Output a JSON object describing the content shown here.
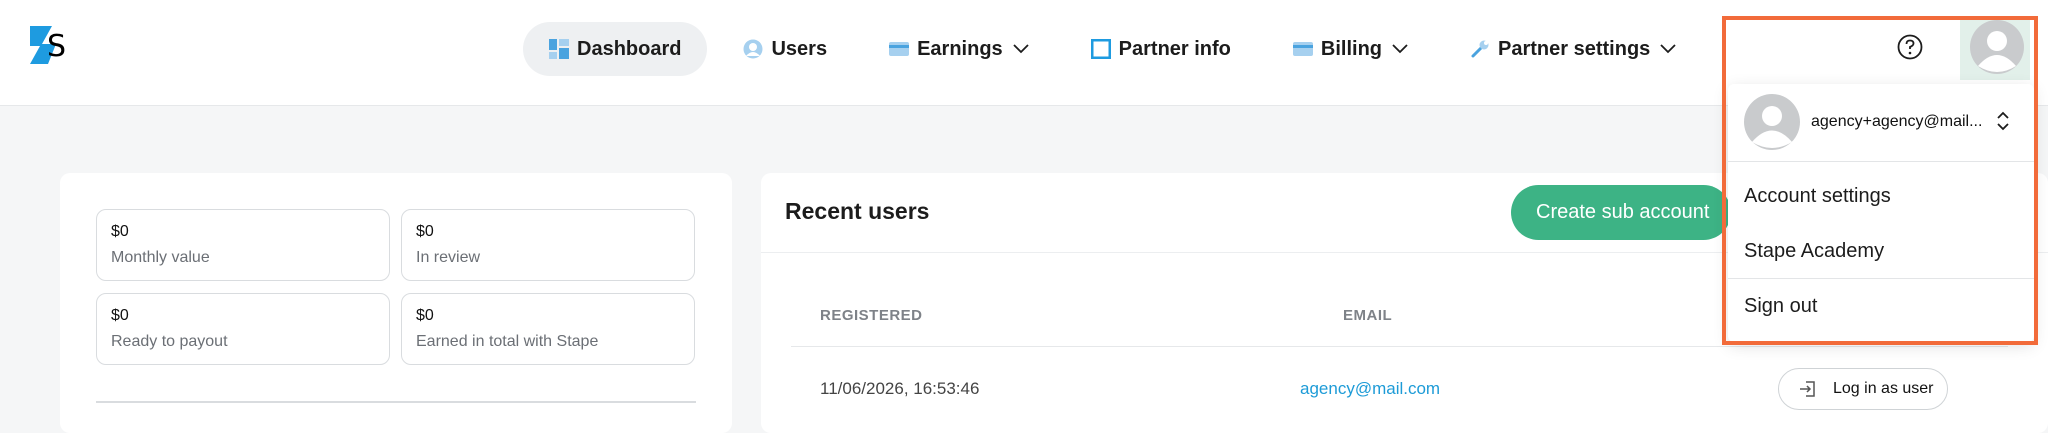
{
  "nav": {
    "dashboard": "Dashboard",
    "users": "Users",
    "earnings": "Earnings",
    "partner_info": "Partner info",
    "billing": "Billing",
    "partner_settings": "Partner settings"
  },
  "stats": {
    "monthly_value": {
      "value": "$0",
      "label": "Monthly value"
    },
    "in_review": {
      "value": "$0",
      "label": "In review"
    },
    "ready_to_payout": {
      "value": "$0",
      "label": "Ready to payout"
    },
    "earned_total": {
      "value": "$0",
      "label": "Earned in total with Stape"
    }
  },
  "recent_users": {
    "title": "Recent users",
    "create_button": "Create sub account",
    "columns": [
      "REGISTERED",
      "EMAIL"
    ],
    "rows": [
      {
        "registered": "11/06/2026, 16:53:46",
        "email": "agency@mail.com",
        "action": "Log in as user"
      }
    ]
  },
  "account_menu": {
    "email": "agency+agency@mail...",
    "items": [
      "Account settings",
      "Stape Academy",
      "Sign out"
    ]
  },
  "colors": {
    "accent_green": "#3db385",
    "link_blue": "#1d9bd7",
    "highlight_orange": "#f26b3a"
  }
}
